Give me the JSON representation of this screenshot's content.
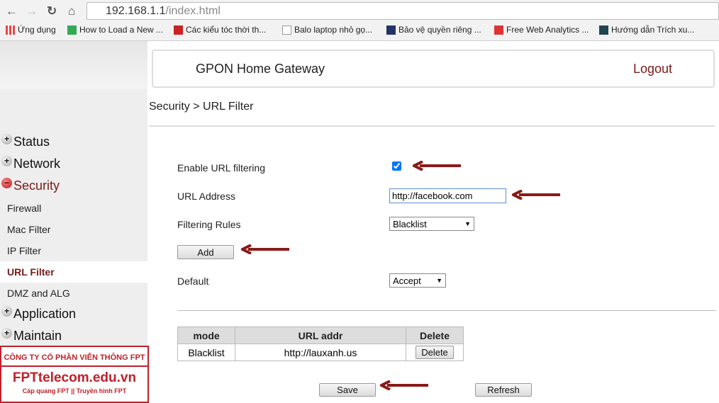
{
  "browser": {
    "url_host": "192.168.1.1",
    "url_path": "/index.html",
    "bookmarks": [
      {
        "label": "Ứng dụng",
        "color": "#e04"
      },
      {
        "label": "How to Load a New ...",
        "color": "#3a5"
      },
      {
        "label": "Các kiểu tóc thời th...",
        "color": "#c22"
      },
      {
        "label": "Balo laptop nhỏ gọ...",
        "color": "#ccc"
      },
      {
        "label": "Bảo vệ quyền riêng ...",
        "color": "#236"
      },
      {
        "label": "Free Web Analytics ...",
        "color": "#d33"
      },
      {
        "label": "Hướng dẫn Trích xu...",
        "color": "#245"
      }
    ]
  },
  "header": {
    "title": "GPON Home Gateway",
    "logout": "Logout"
  },
  "breadcrumb": "Security > URL Filter",
  "sidebar": {
    "menus": [
      {
        "label": "Status",
        "expanded": false
      },
      {
        "label": "Network",
        "expanded": false
      },
      {
        "label": "Security",
        "expanded": true
      },
      {
        "label": "Application",
        "expanded": false
      },
      {
        "label": "Maintain",
        "expanded": false
      }
    ],
    "security_items": [
      "Firewall",
      "Mac Filter",
      "IP Filter",
      "URL Filter",
      "DMZ and ALG"
    ],
    "active": "URL Filter"
  },
  "form": {
    "enable_label": "Enable URL filtering",
    "enabled": true,
    "url_label": "URL Address",
    "url_value": "http://facebook.com",
    "rules_label": "Filtering Rules",
    "rules_value": "Blacklist",
    "add": "Add",
    "default_label": "Default",
    "default_value": "Accept"
  },
  "table": {
    "headers": [
      "mode",
      "URL addr",
      "Delete"
    ],
    "rows": [
      {
        "mode": "Blacklist",
        "url": "http://lauxanh.us",
        "action": "Delete"
      }
    ]
  },
  "actions": {
    "save": "Save",
    "refresh": "Refresh"
  },
  "watermark": {
    "line1": "CÔNG TY CỔ PHẦN VIỄN THÔNG FPT",
    "line2": "FPTtelecom.edu.vn",
    "line3": "Cáp quang FPT || Truyền hình FPT"
  },
  "colors": {
    "accent": "#7a1a1a",
    "arrow": "#8b1a1a",
    "watermark": "#c0202a"
  }
}
